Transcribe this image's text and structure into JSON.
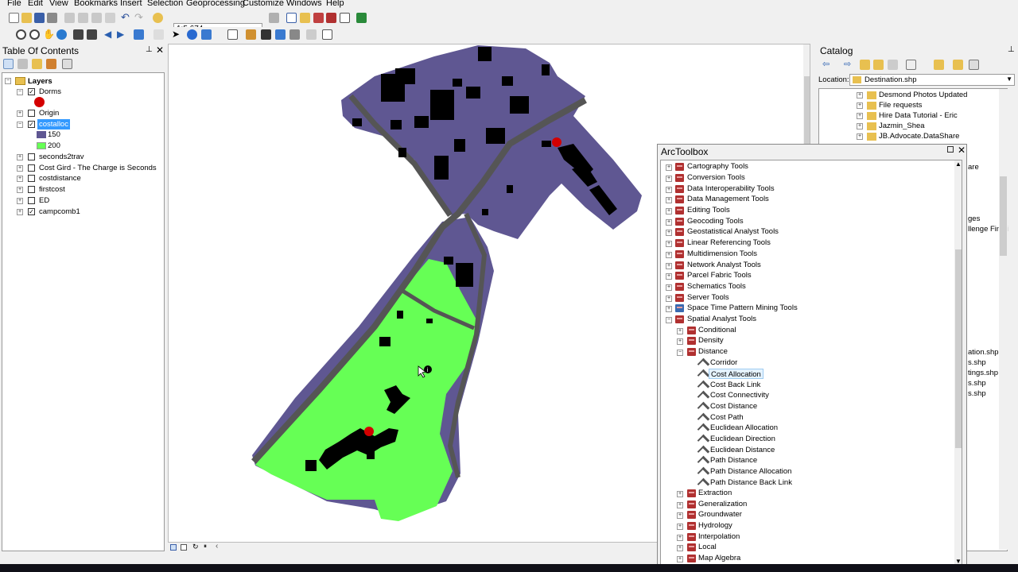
{
  "menu": [
    "File",
    "Edit",
    "View",
    "Bookmarks",
    "Insert",
    "Selection",
    "Geoprocessing",
    "Customize",
    "Windows",
    "Help"
  ],
  "scale_value": "1:5,674",
  "toc": {
    "title": "Table Of Contents",
    "layers_label": "Layers",
    "items": [
      {
        "label": "Dorms",
        "checked": true,
        "expanded": true
      },
      {
        "label": "Origin",
        "checked": false,
        "expanded": false
      },
      {
        "label": "costalloc",
        "checked": true,
        "expanded": true,
        "selected": true
      },
      {
        "label": "seconds2trav",
        "checked": false,
        "expanded": false
      },
      {
        "label": "Cost Gird - The Charge is Seconds",
        "checked": false,
        "expanded": false
      },
      {
        "label": "costdistance",
        "checked": false,
        "expanded": false
      },
      {
        "label": "firstcost",
        "checked": false,
        "expanded": false
      },
      {
        "label": "ED",
        "checked": false,
        "expanded": false
      },
      {
        "label": "campcomb1",
        "checked": true,
        "expanded": false
      }
    ],
    "legend": [
      {
        "label": "150",
        "color": "#5f5792"
      },
      {
        "label": "200",
        "color": "#66ff55"
      }
    ],
    "dorms_symbol_color": "#d40000"
  },
  "catalog": {
    "title": "Catalog",
    "location_label": "Location:",
    "location_value": "Destination.shp",
    "tree": [
      "Desmond Photos Updated",
      "File requests",
      "Hire Data Tutorial - Eric",
      "Jazmin_Shea",
      "JB.Advocate.DataShare"
    ],
    "partial_labels": [
      "are",
      "ges",
      "llenge Finali",
      "ation.shp",
      "s.shp",
      "tings.shp",
      "s.shp",
      "s.shp"
    ]
  },
  "arctoolbox": {
    "title": "ArcToolbox",
    "toolboxes": [
      "Cartography Tools",
      "Conversion Tools",
      "Data Interoperability Tools",
      "Data Management Tools",
      "Editing Tools",
      "Geocoding Tools",
      "Geostatistical Analyst Tools",
      "Linear Referencing Tools",
      "Multidimension Tools",
      "Network Analyst Tools",
      "Parcel Fabric Tools",
      "Schematics Tools",
      "Server Tools",
      "Space Time Pattern Mining Tools",
      "Spatial Analyst Tools"
    ],
    "spatial_sub_before": [
      "Conditional",
      "Density"
    ],
    "distance_label": "Distance",
    "distance_tools": [
      "Corridor",
      "Cost Allocation",
      "Cost Back Link",
      "Cost Connectivity",
      "Cost Distance",
      "Cost Path",
      "Euclidean Allocation",
      "Euclidean Direction",
      "Euclidean Distance",
      "Path Distance",
      "Path Distance Allocation",
      "Path Distance Back Link"
    ],
    "selected_tool": "Cost Allocation",
    "spatial_sub_after": [
      "Extraction",
      "Generalization",
      "Groundwater",
      "Hydrology",
      "Interpolation",
      "Local",
      "Map Algebra"
    ]
  },
  "colors": {
    "zone_150": "#5f5792",
    "zone_200": "#66ff55",
    "roads": "#555555",
    "buildings": "#000000",
    "points": "#d40000",
    "selection": "#3399ff"
  }
}
